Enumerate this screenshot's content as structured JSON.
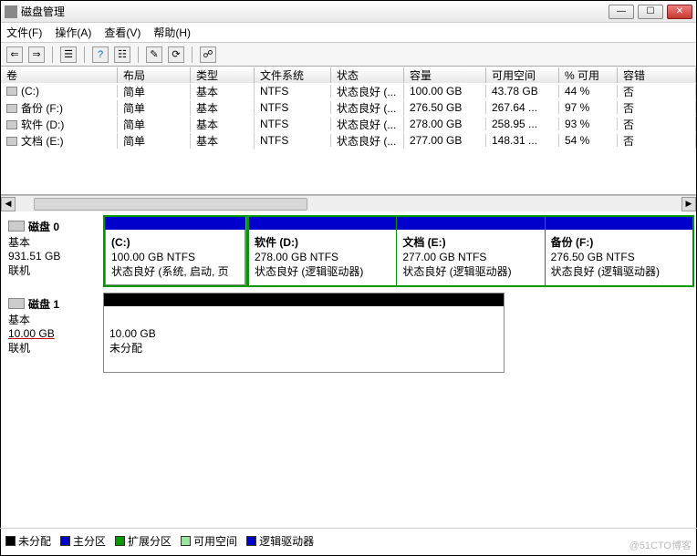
{
  "window": {
    "title": "磁盘管理"
  },
  "menu": {
    "file": "文件(F)",
    "action": "操作(A)",
    "view": "查看(V)",
    "help": "帮助(H)"
  },
  "columns": {
    "c0": "卷",
    "c1": "布局",
    "c2": "类型",
    "c3": "文件系统",
    "c4": "状态",
    "c5": "容量",
    "c6": "可用空间",
    "c7": "% 可用",
    "c8": "容错"
  },
  "rows": [
    {
      "vol": "(C:)",
      "layout": "简单",
      "type": "基本",
      "fs": "NTFS",
      "status": "状态良好 (...",
      "cap": "100.00 GB",
      "free": "43.78 GB",
      "pct": "44 %",
      "ft": "否"
    },
    {
      "vol": "备份 (F:)",
      "layout": "简单",
      "type": "基本",
      "fs": "NTFS",
      "status": "状态良好 (...",
      "cap": "276.50 GB",
      "free": "267.64 ...",
      "pct": "97 %",
      "ft": "否"
    },
    {
      "vol": "软件 (D:)",
      "layout": "简单",
      "type": "基本",
      "fs": "NTFS",
      "status": "状态良好 (...",
      "cap": "278.00 GB",
      "free": "258.95 ...",
      "pct": "93 %",
      "ft": "否"
    },
    {
      "vol": "文档 (E:)",
      "layout": "简单",
      "type": "基本",
      "fs": "NTFS",
      "status": "状态良好 (...",
      "cap": "277.00 GB",
      "free": "148.31 ...",
      "pct": "54 %",
      "ft": "否"
    }
  ],
  "disk0": {
    "label": "磁盘 0",
    "type": "基本",
    "size": "931.51 GB",
    "status": "联机",
    "parts": [
      {
        "name": "(C:)",
        "size": "100.00 GB NTFS",
        "state": "状态良好 (系统, 启动, 页"
      },
      {
        "name": "软件  (D:)",
        "size": "278.00 GB NTFS",
        "state": "状态良好 (逻辑驱动器)"
      },
      {
        "name": "文档  (E:)",
        "size": "277.00 GB NTFS",
        "state": "状态良好 (逻辑驱动器)"
      },
      {
        "name": "备份  (F:)",
        "size": "276.50 GB NTFS",
        "state": "状态良好 (逻辑驱动器)"
      }
    ]
  },
  "disk1": {
    "label": "磁盘 1",
    "type": "基本",
    "size": "10.00 GB",
    "status": "联机",
    "part": {
      "size": "10.00 GB",
      "state": "未分配"
    }
  },
  "legend": {
    "unalloc": "未分配",
    "primary": "主分区",
    "ext": "扩展分区",
    "free": "可用空间",
    "logical": "逻辑驱动器"
  },
  "watermark": "@51CTO博客"
}
